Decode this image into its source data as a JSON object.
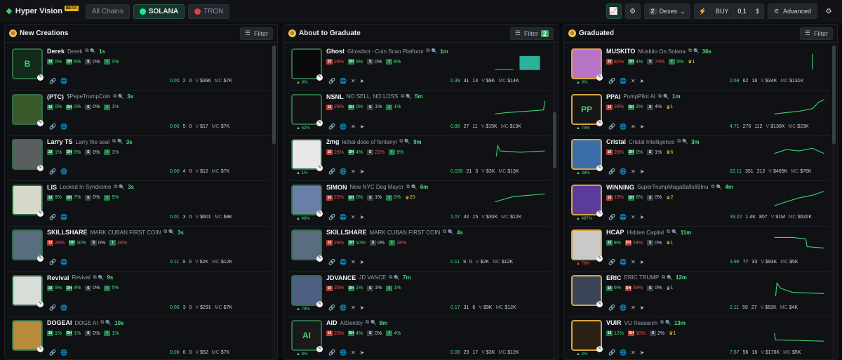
{
  "app": {
    "title": "Hyper Vision",
    "badge": "BETA",
    "chains": [
      "All Chains",
      "SOLANA",
      "TRON"
    ],
    "dexes_count": "2",
    "dexes_label": "Dexes",
    "buy_label": "BUY",
    "buy_amount": "0,1",
    "buy_unit": "$",
    "advanced_label": "Advanced"
  },
  "columns": [
    {
      "title": "New Creations",
      "filter_label": "Filter",
      "filter_count": "",
      "cards": [
        {
          "name": "Derek",
          "full": "Derek",
          "age": "1s",
          "s1": "0%",
          "s2": "6%",
          "s3": "0%",
          "s4": "0%",
          "pct": "",
          "vol": "0.00",
          "holders": "2",
          "txs": "0",
          "v": "$396",
          "mc": "$7K",
          "img": "B",
          "bg": "#112a1a"
        },
        {
          "name": "(PTC)",
          "full": "$PepeTrumpCoin",
          "age": "3s",
          "s1": "0%",
          "s2": "0%",
          "s3": "0%",
          "s4": "1%",
          "pct": "",
          "vol": "0.00",
          "holders": "5",
          "txs": "0",
          "v": "$17",
          "mc": "$7K",
          "img": "",
          "bg": "#3b5a2c"
        },
        {
          "name": "Larry TS",
          "full": "Larry the seal",
          "age": "3s",
          "s1": "1%",
          "s2": "0%",
          "s3": "0%",
          "s4": "1%",
          "pct": "",
          "vol": "0.00",
          "holders": "4",
          "txs": "0",
          "v": "$12",
          "mc": "$7K",
          "img": "",
          "bg": "#5b5e60"
        },
        {
          "name": "LIS",
          "full": "Locked In Syndrome",
          "age": "3s",
          "s1": "9%",
          "s2": "7%",
          "s3": "0%",
          "s4": "9%",
          "pct": "",
          "vol": "0.01",
          "holders": "3",
          "txs": "0",
          "v": "$601",
          "mc": "$8K",
          "img": "",
          "bg": "#d8d8c8"
        },
        {
          "name": "SKILLSHARE",
          "full": "MARK CUBAN FIRST COIN",
          "age": "3s",
          "s1": "28%",
          "s2": "10%",
          "s3": "0%",
          "s4": "28%",
          "pct": "",
          "vol": "0.11",
          "holders": "9",
          "txs": "0",
          "v": "$2K",
          "mc": "$12K",
          "img": "",
          "bg": "#5a6c80"
        },
        {
          "name": "Revival",
          "full": "Revival",
          "age": "9s",
          "s1": "5%",
          "s2": "4%",
          "s3": "0%",
          "s4": "5%",
          "pct": "",
          "vol": "0.00",
          "holders": "3",
          "txs": "0",
          "v": "$291",
          "mc": "$7K",
          "img": "",
          "bg": "#d9ddd8"
        },
        {
          "name": "DOGEAI",
          "full": "DOGE AI",
          "age": "10s",
          "s1": "1%",
          "s2": "1%",
          "s3": "0%",
          "s4": "1%",
          "pct": "",
          "vol": "0.00",
          "holders": "6",
          "txs": "0",
          "v": "$52",
          "mc": "$7K",
          "img": "",
          "bg": "#b78a3c"
        }
      ]
    },
    {
      "title": "About to Graduate",
      "filter_label": "Filter",
      "filter_count": "2",
      "cards": [
        {
          "name": "Ghost",
          "full": "Ghostbot - Coin Scan Platform",
          "age": "1m",
          "s1": "28%",
          "s2": "5%",
          "s3": "0%",
          "s4": "8%",
          "pct": "9%",
          "vol": "0.39",
          "holders": "31",
          "txs": "14",
          "v": "$9K",
          "mc": "$14K",
          "img": "",
          "bg": "#0a0a0a"
        },
        {
          "name": "NSNL",
          "full": "NO SELL, NO LOSS",
          "age": "5m",
          "s1": "28%",
          "s2": "0%",
          "s3": "1%",
          "s4": "1%",
          "pct": "52%",
          "vol": "0.88",
          "holders": "27",
          "txs": "11",
          "v": "$15K",
          "mc": "$13K",
          "img": "",
          "bg": "#121212"
        },
        {
          "name": "2mg",
          "full": "lethal dose of fentanyl",
          "age": "9m",
          "s1": "26%",
          "s2": "4%",
          "s3": "21%",
          "s4": "9%",
          "pct": "1%",
          "vol": "0.039",
          "holders": "21",
          "txs": "3",
          "v": "$3K",
          "mc": "$13K",
          "img": "",
          "bg": "#e8e8e8"
        },
        {
          "name": "SIMON",
          "full": "New NYC Dog Mayor",
          "age": "6m",
          "s1": "23%",
          "s2": "0%",
          "s3": "1%",
          "s4": "0%",
          "crown": "20",
          "pct": "46%",
          "vol": "1.07",
          "holders": "32",
          "txs": "15",
          "v": "$30K",
          "mc": "$12K",
          "img": "",
          "bg": "#6a7fa8"
        },
        {
          "name": "SKILLSHARE",
          "full": "MARK CUBAN FIRST COIN",
          "age": "4s",
          "s1": "28%",
          "s2": "10%",
          "s3": "0%",
          "s4": "28%",
          "pct": "",
          "vol": "0.11",
          "holders": "9",
          "txs": "0",
          "v": "$2K",
          "mc": "$12K",
          "img": "",
          "bg": "#5a6c80"
        },
        {
          "name": "JDVANCE",
          "full": "JD VANCE",
          "age": "7m",
          "s1": "26%",
          "s2": "1%",
          "s3": "1%",
          "s4": "1%",
          "pct": "79%",
          "vol": "0.17",
          "holders": "31",
          "txs": "6",
          "v": "$9K",
          "mc": "$12K",
          "img": "",
          "bg": "#4d5f82"
        },
        {
          "name": "AID",
          "full": "AIDentity",
          "age": "8m",
          "s1": "20%",
          "s2": "4%",
          "s3": "0%",
          "s4": "4%",
          "pct": "8%",
          "vol": "0.08",
          "holders": "29",
          "txs": "17",
          "v": "$3K",
          "mc": "$12K",
          "img": "AI",
          "bg": "#1a1a1a"
        }
      ]
    },
    {
      "title": "Graduated",
      "filter_label": "Filter",
      "filter_count": "",
      "cards": [
        {
          "name": "MUSKITO",
          "full": "Muskito On Solana",
          "age": "36s",
          "s1": "81%",
          "s2": "4%",
          "s3": "74%",
          "s4": "5%",
          "crown": "1",
          "pct": "0%",
          "vol": "0.59",
          "holders": "62",
          "txs": "16",
          "v": "$34K",
          "mc": "$131K",
          "img": "",
          "bg": "#b774c6"
        },
        {
          "name": "PPAI",
          "full": "PumpPilot AI",
          "age": "1m",
          "s1": "28%",
          "s2": "2%",
          "s3": "4%",
          "s4": "",
          "crown": "1",
          "pct": "74%",
          "vol": "4.71",
          "holders": "276",
          "txs": "112",
          "v": "$130K",
          "mc": "$23K",
          "img": "PP",
          "bg": "#161616"
        },
        {
          "name": "Cristal",
          "full": "Cristal Intelligence",
          "age": "3m",
          "s1": "28%",
          "s2": "0%",
          "s3": "1%",
          "s4": "",
          "crown": "6",
          "pct": "38%",
          "vol": "22.11",
          "holders": "351",
          "txs": "212",
          "v": "$465K",
          "mc": "$76K",
          "img": "",
          "bg": "#3b6ea8"
        },
        {
          "name": "WINNING",
          "full": "SuperTrumpMagaBalls69Inu",
          "age": "4m",
          "s1": "19%",
          "s2": "6%",
          "s3": "0%",
          "s4": "",
          "crown": "2",
          "pct": "487%",
          "vol": "33.22",
          "holders": "1.4K",
          "txs": "807",
          "v": "$1M",
          "mc": "$632K",
          "img": "",
          "bg": "#5b3c9a"
        },
        {
          "name": "HCAP",
          "full": "Hidden Capital",
          "age": "11m",
          "s1": "8%",
          "s2": "54%",
          "s3": "0%",
          "s4": "",
          "crown": "1",
          "pct": "78%",
          "vol": "3.96",
          "holders": "77",
          "txs": "33",
          "v": "$93K",
          "mc": "$5K",
          "img": "",
          "bg": "#c9c9c9"
        },
        {
          "name": "ERIC",
          "full": "ERIC TRUMP",
          "age": "12m",
          "s1": "6%",
          "s2": "59%",
          "s3": "0%",
          "s4": "",
          "crown": "1",
          "pct": "",
          "vol": "2.11",
          "holders": "59",
          "txs": "27",
          "v": "$62K",
          "mc": "$4K",
          "img": "",
          "bg": "#3a4358"
        },
        {
          "name": "VUIR",
          "full": "VU Research",
          "age": "13m",
          "s1": "12%",
          "s2": "30%",
          "s3": "2%",
          "s4": "",
          "crown": "1",
          "pct": "2%",
          "vol": "7.87",
          "holders": "56",
          "txs": "16",
          "v": "$176K",
          "mc": "$5K",
          "img": "",
          "bg": "#2a2114"
        }
      ]
    }
  ]
}
